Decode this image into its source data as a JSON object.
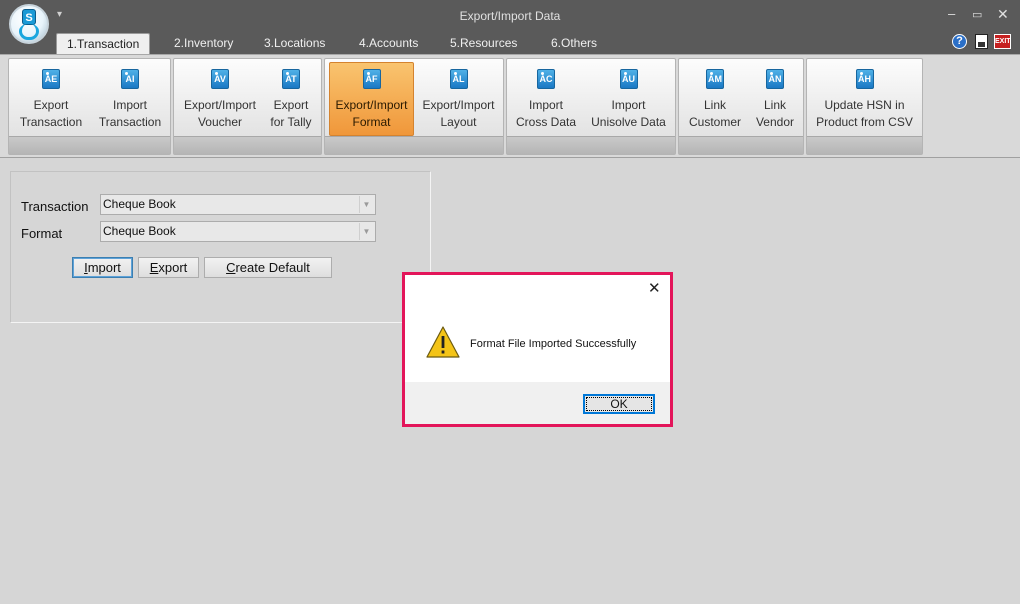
{
  "window": {
    "title": "Export/Import Data",
    "controls": {
      "minimize": "–",
      "maximize": "▭",
      "close": "✕"
    }
  },
  "logo": {
    "letter": "S"
  },
  "tabs": [
    {
      "label": "1.Transaction",
      "active": true
    },
    {
      "label": "2.Inventory"
    },
    {
      "label": "3.Locations"
    },
    {
      "label": "4.Accounts"
    },
    {
      "label": "5.Resources"
    },
    {
      "label": "6.Others"
    }
  ],
  "tab_icons": {
    "help": "?",
    "exit": "EXIT"
  },
  "ribbon": {
    "buttons": [
      {
        "line1": "Export",
        "line2": "Transaction",
        "icon": "AE"
      },
      {
        "line1": "Import",
        "line2": "Transaction",
        "icon": "AI"
      },
      {
        "line1": "Export/Import",
        "line2": "Voucher",
        "icon": "AV"
      },
      {
        "line1": "Export",
        "line2": "for Tally",
        "icon": "AT"
      },
      {
        "line1": "Export/Import",
        "line2": "Format",
        "icon": "AF",
        "selected": true
      },
      {
        "line1": "Export/Import",
        "line2": "Layout",
        "icon": "AL"
      },
      {
        "line1": "Import",
        "line2": "Cross Data",
        "icon": "AC"
      },
      {
        "line1": "Import",
        "line2": "Unisolve Data",
        "icon": "AU"
      },
      {
        "line1": "Link",
        "line2": "Customer",
        "icon": "AM"
      },
      {
        "line1": "Link",
        "line2": "Vendor",
        "icon": "AN"
      },
      {
        "line1": "Update HSN in",
        "line2": "Product from CSV",
        "icon": "AH"
      }
    ]
  },
  "form": {
    "transaction_label": "Transaction",
    "transaction_value": "Cheque Book",
    "format_label": "Format",
    "format_value": "Cheque Book",
    "import_mnemonic": "I",
    "import_rest": "mport",
    "export_mnemonic": "E",
    "export_rest": "xport",
    "default_mnemonic": "C",
    "default_rest": "reate Default"
  },
  "dialog": {
    "close": "✕",
    "message": "Format File Imported Successfully",
    "ok_label": "OK"
  },
  "colors": {
    "highlight": "#e3155a",
    "selected_button": "#f0973a",
    "titlebar": "#5a5a5a"
  }
}
